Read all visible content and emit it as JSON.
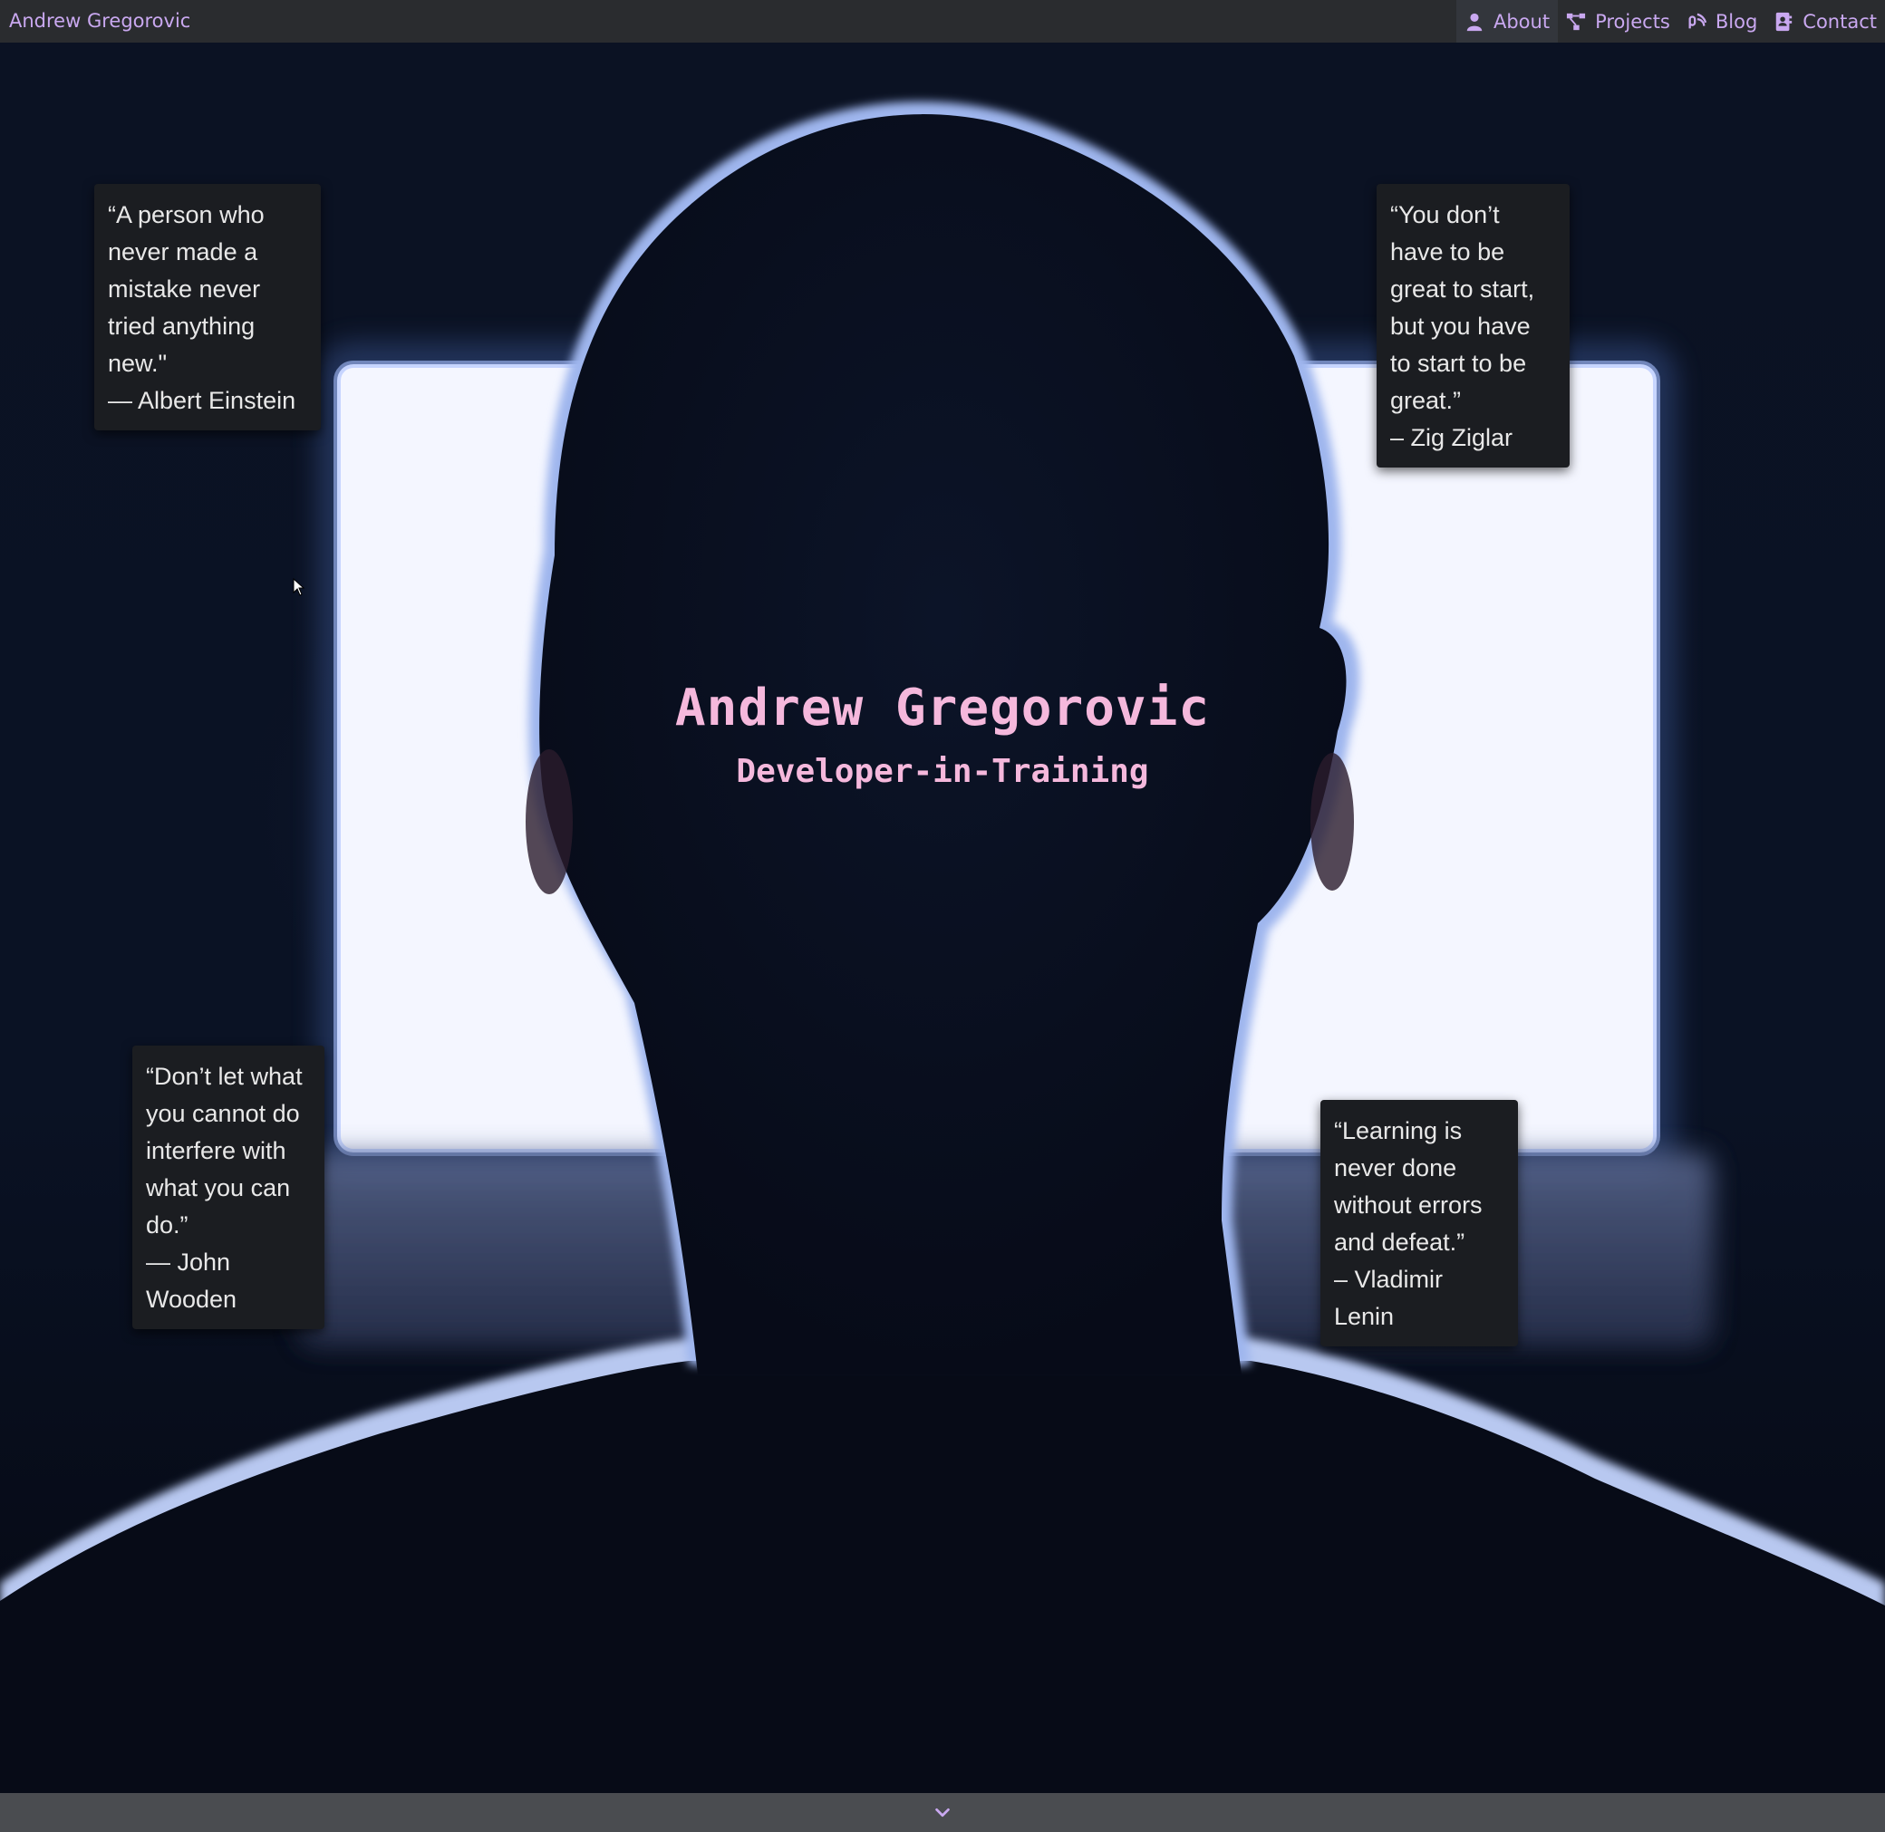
{
  "navbar": {
    "brand": "Andrew Gregorovic",
    "items": [
      {
        "label": "About",
        "icon": "user-icon",
        "active": true
      },
      {
        "label": "Projects",
        "icon": "project-diagram-icon",
        "active": false
      },
      {
        "label": "Blog",
        "icon": "blog-icon",
        "active": false
      },
      {
        "label": "Contact",
        "icon": "address-book-icon",
        "active": false
      }
    ]
  },
  "hero": {
    "title": "Andrew Gregorovic",
    "subtitle": "Developer-in-Training"
  },
  "quotes": [
    {
      "text": "“A person who never made a mistake never tried anything new.\"",
      "author": "— Albert Einstein"
    },
    {
      "text": "“You don’t have to be great to start, but you have to start to be great.”",
      "author": "– Zig Ziglar"
    },
    {
      "text": "“Don’t let what you cannot do interfere with what you can do.”",
      "author": "— John Wooden"
    },
    {
      "text": "“Learning is never done without errors and defeat.”",
      "author": "– Vladimir Lenin"
    }
  ],
  "footer": {
    "scroll_icon": "chevron-down-icon"
  },
  "colors": {
    "accent": "#c9a8f0",
    "title": "#f5b8dc",
    "navbar_bg": "#2a2c2f",
    "card_bg": "#1b1d21"
  }
}
